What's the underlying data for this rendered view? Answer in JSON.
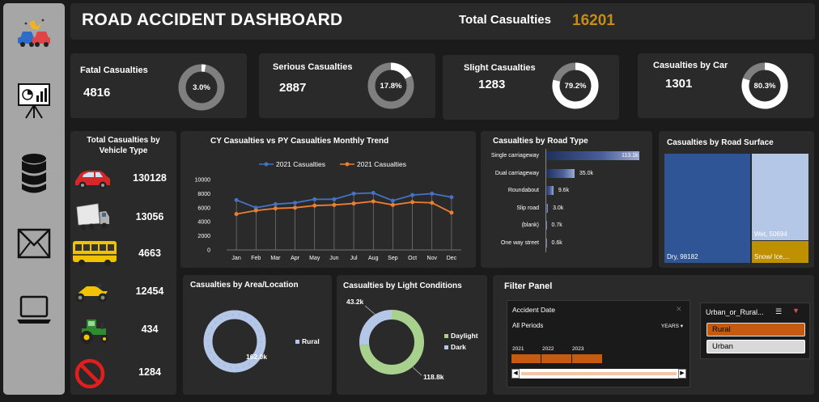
{
  "header": {
    "title": "ROAD ACCIDENT DASHBOARD",
    "total_label": "Total Casualties",
    "total_value": "16201"
  },
  "sidebar": {
    "icons": [
      "car-crash-icon",
      "presentation-chart-icon",
      "database-icon",
      "mail-icon",
      "laptop-icon"
    ]
  },
  "kpis": [
    {
      "label": "Fatal Casualties",
      "value": "4816",
      "percent_text": "3.0%",
      "percent": 0.03
    },
    {
      "label": "Serious Casualties",
      "value": "2887",
      "percent_text": "17.8%",
      "percent": 0.178
    },
    {
      "label": "Slight Casualties",
      "value": "1283",
      "percent_text": "79.2%",
      "percent": 0.792
    },
    {
      "label": "Casualties by Car",
      "value": "1301",
      "percent_text": "80.3%",
      "percent": 0.803
    }
  ],
  "vehicle": {
    "title_line1": "Total Casualties by",
    "title_line2": "Vehicle Type",
    "items": [
      {
        "icon": "car-icon",
        "value": "130128"
      },
      {
        "icon": "truck-icon",
        "value": "13056"
      },
      {
        "icon": "bus-icon",
        "value": "4663"
      },
      {
        "icon": "motorcycle-icon",
        "value": "12454"
      },
      {
        "icon": "tractor-icon",
        "value": "434"
      },
      {
        "icon": "no-entry-icon",
        "value": "1284"
      }
    ]
  },
  "trend": {
    "title": "CY Casualties vs PY Casualties Monthly Trend",
    "legend": [
      "2021 Casualties",
      "2021 Casualties"
    ],
    "colors": [
      "#4472c4",
      "#ed7d31"
    ]
  },
  "road_type": {
    "title": "Casualties by Road Type",
    "bar_color": "#4a5e9a"
  },
  "surface": {
    "title": "Casualties by Road Surface",
    "dry": "Dry, 98182",
    "wet": "Wet, 50694",
    "snow": "Snow/ Ice,...",
    "dry_color": "#2f5597",
    "wet_color": "#b4c7e7",
    "snow_color": "#bf9000"
  },
  "area": {
    "title": "Casualties by Area/Location",
    "value_label": "162.0k",
    "legend": "Rural"
  },
  "light": {
    "title": "Casualties by Light Conditions",
    "label_dark": "43.2k",
    "label_day": "118.8k",
    "legend": [
      "Daylight",
      "Dark"
    ]
  },
  "filter": {
    "title": "Filter Panel",
    "timeline_title": "Accident  Date",
    "all_periods": "All Periods",
    "years_label": "YEARS",
    "years": [
      "2021",
      "2022",
      "2023"
    ],
    "slicer_title": "Urban_or_Rural...",
    "options": [
      "Rural",
      "Urban"
    ]
  },
  "chart_data": [
    {
      "type": "line",
      "title": "CY Casualties vs PY Casualties Monthly Trend",
      "categories": [
        "Jan",
        "Feb",
        "Mar",
        "Apr",
        "May",
        "Jun",
        "Jul",
        "Aug",
        "Sep",
        "Oct",
        "Nov",
        "Dec"
      ],
      "series": [
        {
          "name": "2021 Casualties",
          "values": [
            7100,
            6000,
            6500,
            6700,
            7200,
            7200,
            8000,
            8100,
            7000,
            7800,
            8000,
            7500
          ]
        },
        {
          "name": "2021 Casualties",
          "values": [
            5100,
            5600,
            5900,
            6000,
            6300,
            6400,
            6600,
            6900,
            6400,
            6800,
            6700,
            5300
          ]
        }
      ],
      "yticks": [
        "0",
        "2000",
        "4000",
        "6000",
        "8000",
        "10000"
      ],
      "ylim": [
        0,
        10000
      ],
      "legend": "top"
    },
    {
      "type": "bar",
      "title": "Casualties by Road Type",
      "categories": [
        "Single carriageway",
        "Dual carriageway",
        "Roundabout",
        "Slip road",
        "(blank)",
        "One way street"
      ],
      "values": [
        113100,
        35000,
        9600,
        3000,
        700,
        600
      ],
      "labels": [
        "113.1k",
        "35.0k",
        "9.6k",
        "3.0k",
        "0.7k",
        "0.6k"
      ]
    },
    {
      "type": "pie",
      "title": "Casualties by Light Conditions",
      "categories": [
        "Daylight",
        "Dark"
      ],
      "values": [
        118800,
        43200
      ]
    },
    {
      "type": "pie",
      "title": "Casualties by Area/Location",
      "categories": [
        "Rural"
      ],
      "values": [
        162000
      ]
    }
  ]
}
